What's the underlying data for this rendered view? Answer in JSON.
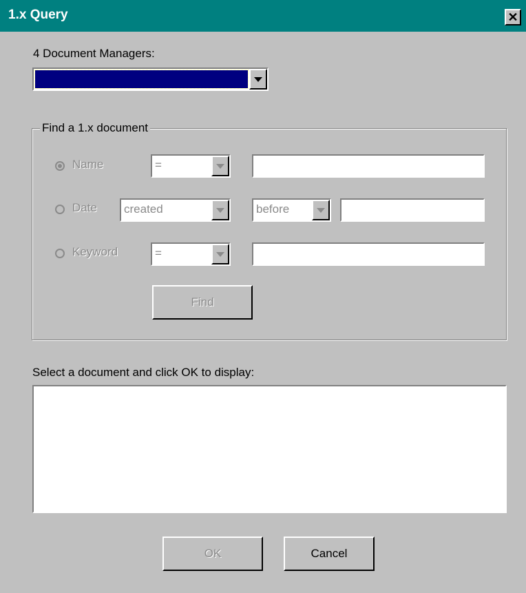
{
  "window": {
    "title": "1.x Query",
    "close_glyph": "✕"
  },
  "managers": {
    "label": "4 Document Managers:",
    "selected_value": "",
    "selected_bg": "#000080"
  },
  "find_group": {
    "label": "Find a 1.x document",
    "name_row": {
      "label": "Name",
      "operator": "=",
      "value": "",
      "selected": true
    },
    "date_row": {
      "label": "Date",
      "field": "created",
      "operator": "before",
      "value": "",
      "selected": false
    },
    "keyword_row": {
      "label": "Keyword",
      "operator": "=",
      "value": "",
      "selected": false
    },
    "find_label": "Find"
  },
  "results": {
    "label": "Select a document and click OK to display:",
    "items": []
  },
  "buttons": {
    "ok_label": "OK",
    "cancel_label": "Cancel"
  },
  "colors": {
    "titlebar": "#008080",
    "face": "#c0c0c0",
    "disabled_text": "#8a8a8a"
  },
  "icons": {
    "dropdown": "chevron-down-icon",
    "close": "close-icon"
  }
}
